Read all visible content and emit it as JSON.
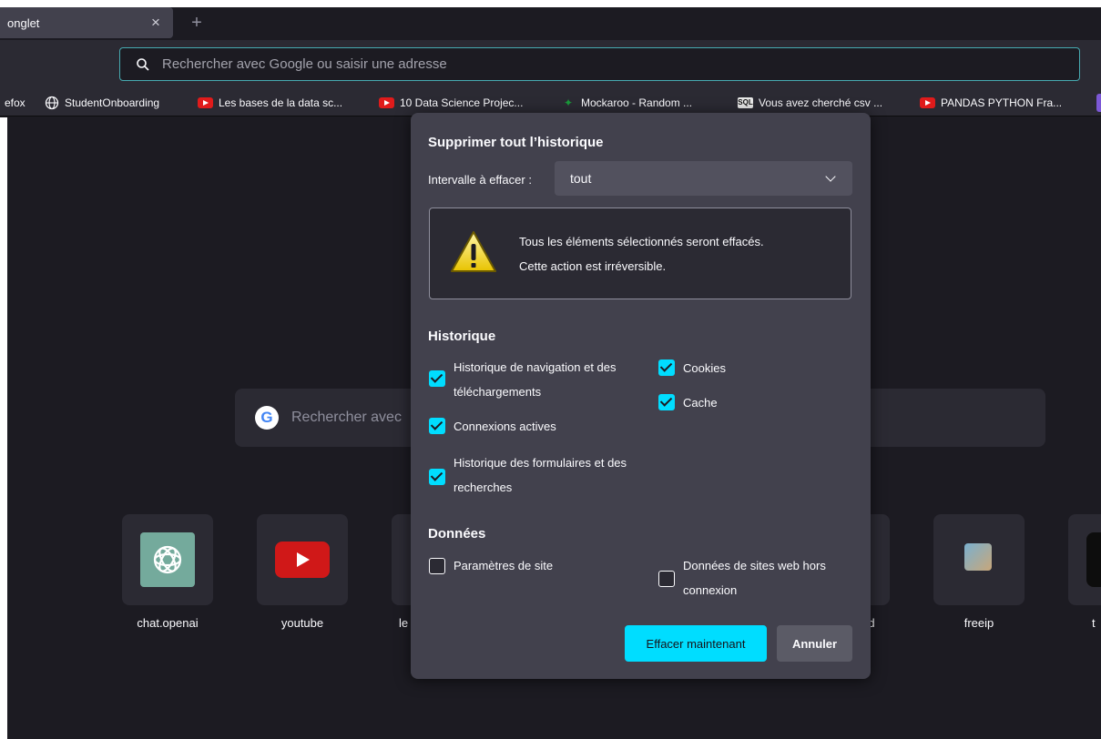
{
  "browser": {
    "tab": {
      "title": "onglet",
      "close_glyph": "×"
    },
    "new_tab_glyph": "+",
    "urlbar": {
      "placeholder": "Rechercher avec Google ou saisir une adresse"
    },
    "bookmarks": [
      {
        "label": "efox",
        "icon": "none"
      },
      {
        "label": "StudentOnboarding",
        "icon": "globe-icon"
      },
      {
        "label": "Les bases de la data sc...",
        "icon": "youtube-icon"
      },
      {
        "label": "10 Data Science Projec...",
        "icon": "youtube-icon"
      },
      {
        "label": "Mockaroo - Random ...",
        "icon": "mockaroo-icon"
      },
      {
        "label": "Vous avez cherché csv ...",
        "icon": "sql-icon"
      },
      {
        "label": "PANDAS PYTHON Fra...",
        "icon": "youtube-icon"
      }
    ],
    "sql_icon_text": "SQL"
  },
  "newtab": {
    "search_placeholder": "Rechercher avec",
    "google_letter": "G",
    "tiles": [
      {
        "label": "chat.openai",
        "icon": "openai-icon"
      },
      {
        "label": "youtube",
        "icon": "youtube-icon"
      },
      {
        "label": "le",
        "icon": "none"
      },
      {
        "label": "d",
        "icon": "none"
      },
      {
        "label": "freeip",
        "icon": "freeip-icon"
      },
      {
        "label": "t",
        "icon": "dark-icon"
      }
    ]
  },
  "dialog": {
    "title": "Supprimer tout l’historique",
    "range_label": "Intervalle à effacer :",
    "range_value": "tout",
    "warning_line1": "Tous les éléments sélectionnés seront effacés.",
    "warning_line2": "Cette action est irréversible.",
    "history_section": "Historique",
    "history_items": [
      {
        "label": "Historique de navigation et des",
        "label2": "téléchargements",
        "checked": true
      },
      {
        "label": "Connexions actives",
        "checked": true
      },
      {
        "label": "Historique des formulaires et des",
        "label2": "recherches",
        "checked": true
      },
      {
        "label": "Cookies",
        "checked": true
      },
      {
        "label": "Cache",
        "checked": true
      }
    ],
    "data_section": "Données",
    "data_items": [
      {
        "label": "Paramètres de site",
        "checked": false
      },
      {
        "label": "Données de sites web hors",
        "label2": "connexion",
        "checked": false
      }
    ],
    "clear_button": "Effacer maintenant",
    "cancel_button": "Annuler"
  },
  "colors": {
    "accent": "#00ddff",
    "dialog_bg": "#42414d",
    "page_bg": "#1c1b22",
    "urlbar_border": "#47aab1"
  }
}
